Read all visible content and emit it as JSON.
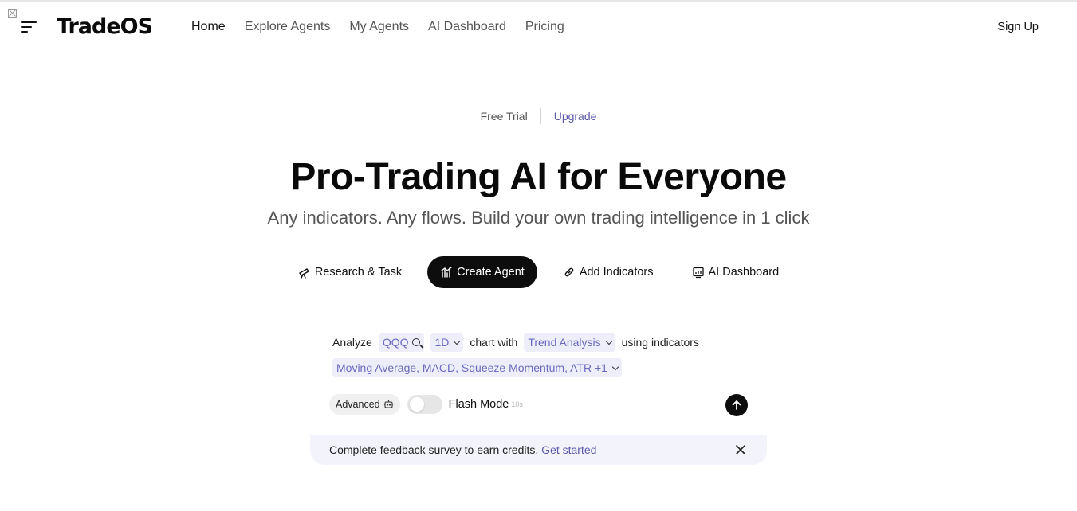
{
  "header": {
    "logo_text": "TradeOS",
    "nav": [
      {
        "label": "Home"
      },
      {
        "label": "Explore Agents"
      },
      {
        "label": "My Agents"
      },
      {
        "label": "AI Dashboard"
      },
      {
        "label": "Pricing"
      }
    ],
    "signup_label": "Sign Up"
  },
  "plan": {
    "free_label": "Free Trial",
    "upgrade_label": "Upgrade"
  },
  "hero": {
    "title": "Pro-Trading AI for Everyone",
    "subtitle": "Any indicators. Any flows. Build your own trading intelligence in 1 click"
  },
  "modes": [
    {
      "label": "Research & Task",
      "icon": "telescope-icon"
    },
    {
      "label": "Create Agent",
      "icon": "chart-bars-icon",
      "active": true
    },
    {
      "label": "Add Indicators",
      "icon": "link-icon"
    },
    {
      "label": "AI Dashboard",
      "icon": "dashboard-icon"
    }
  ],
  "composer": {
    "analyze_label": "Analyze",
    "ticker": "QQQ",
    "timeframe": "1D",
    "chart_with_label": "chart with",
    "analysis_type": "Trend Analysis",
    "using_label": "using indicators",
    "indicators": "Moving Average, MACD, Squeeze Momentum, ATR +1",
    "advanced_label": "Advanced",
    "flash_mode_label": "Flash Mode",
    "flash_mode_sub": "10s",
    "flash_mode_on": false
  },
  "banner": {
    "text": "Complete feedback survey to earn credits.",
    "link": "Get started"
  },
  "colors": {
    "accent": "#5a5aa8",
    "pill_bg": "#eeeefb",
    "dark": "#0d0d0d"
  }
}
